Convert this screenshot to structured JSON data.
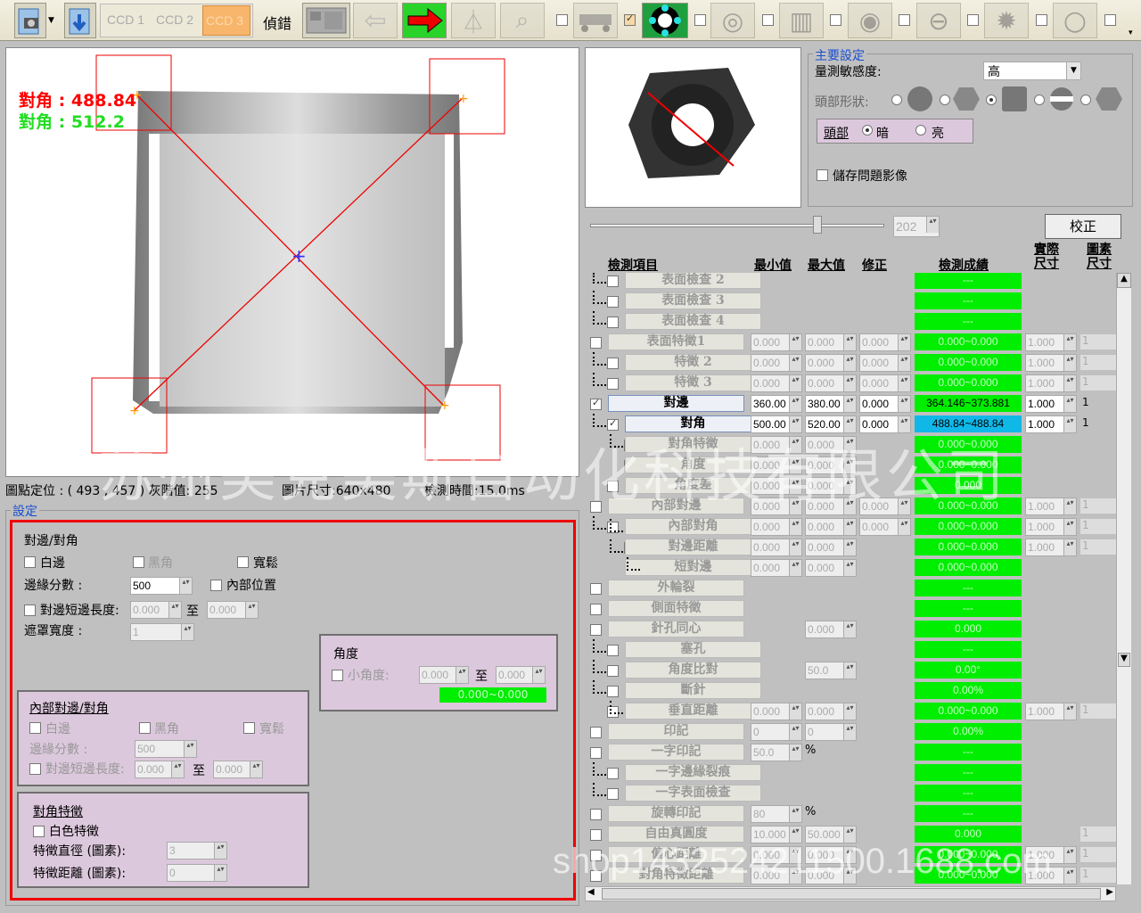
{
  "toolbar": {
    "ccd1": "CCD 1",
    "ccd2": "CCD 2",
    "ccd3": "CCD 3",
    "debug": "偵錯"
  },
  "image_view": {
    "diag_red": "對角 : 488.84",
    "diag_green": "對角 : 512.2",
    "status_pos": "圖點定位 : ( 493 , 457 ) 灰階值: 255",
    "status_size": "圖片尺寸:640x480",
    "status_time": "檢測時間:15.0ms"
  },
  "watermark1": "苏州美克美斯自动化科技有限公司",
  "watermark2": "shop1432524211500.1688.com",
  "settings": {
    "legend": "設定",
    "title": "對邊/對角",
    "white_edge": "白邊",
    "black_corner": "黑角",
    "loose": "寬鬆",
    "edge_score_label": "邊緣分數 :",
    "edge_score": "500",
    "inner_pos": "內部位置",
    "short_edge_label": "對邊短邊長度:",
    "short_min": "0.000",
    "to": "至",
    "short_max": "0.000",
    "mask_label": "遮罩寬度 :",
    "mask": "1",
    "angle_title": "角度",
    "small_angle": "小角度:",
    "angle_min": "0.000",
    "angle_max": "0.000",
    "angle_result": "0.000~0.000",
    "inner_title": "內部對邊/對角",
    "inner_white": "白邊",
    "inner_black": "黑角",
    "inner_loose": "寬鬆",
    "inner_score_label": "邊緣分數 :",
    "inner_score": "500",
    "inner_short_label": "對邊短邊長度:",
    "inner_short_min": "0.000",
    "inner_short_max": "0.000",
    "feat_title": "對角特徵",
    "feat_white": "白色特徵",
    "feat_dia_label": "特徵直徑 (圖素):",
    "feat_dia": "3",
    "feat_dist_label": "特徵距離 (圖素):",
    "feat_dist": "0"
  },
  "main_settings": {
    "legend": "主要設定",
    "sens_label": "量測敏感度:",
    "sens_value": "高",
    "head_shape": "頭部形狀:",
    "head_label": "頭部",
    "dark": "暗",
    "bright": "亮",
    "save_problem": "儲存問題影像"
  },
  "slider_value": "202",
  "calibrate": "校正",
  "table": {
    "h_item": "檢測項目",
    "h_min": "最小值",
    "h_max": "最大值",
    "h_fix": "修正",
    "h_result": "檢測成績",
    "h_real": "實際尺寸",
    "h_pix": "圖素尺寸",
    "rows": [
      {
        "name": "表面檢查 2",
        "min": "",
        "max": "",
        "fix": "",
        "res": "---",
        "real": "",
        "pix": "",
        "act": false
      },
      {
        "name": "表面檢查 3",
        "min": "",
        "max": "",
        "fix": "",
        "res": "---",
        "real": "",
        "pix": "",
        "act": false
      },
      {
        "name": "表面檢查 4",
        "min": "",
        "max": "",
        "fix": "",
        "res": "---",
        "real": "",
        "pix": "",
        "act": false
      },
      {
        "name": "表面特徵1",
        "min": "0.000",
        "max": "0.000",
        "fix": "0.000",
        "res": "0.000~0.000",
        "real": "1.000",
        "pix": "1",
        "act": false
      },
      {
        "name": "特徵 2",
        "min": "0.000",
        "max": "0.000",
        "fix": "0.000",
        "res": "0.000~0.000",
        "real": "1.000",
        "pix": "1",
        "act": false
      },
      {
        "name": "特徵 3",
        "min": "0.000",
        "max": "0.000",
        "fix": "0.000",
        "res": "0.000~0.000",
        "real": "1.000",
        "pix": "1",
        "act": false
      },
      {
        "name": "對邊",
        "min": "360.00",
        "max": "380.00",
        "fix": "0.000",
        "res": "364.146~373.881",
        "real": "1.000",
        "pix": "1",
        "act": true
      },
      {
        "name": "對角",
        "min": "500.00",
        "max": "520.00",
        "fix": "0.000",
        "res": "488.84~488.84",
        "real": "1.000",
        "pix": "1",
        "act": true,
        "blue": true
      },
      {
        "name": "對角特徵",
        "min": "0.000",
        "max": "0.000",
        "fix": "",
        "res": "0.000~0.000",
        "real": "",
        "pix": "",
        "act": false
      },
      {
        "name": "角度",
        "min": "0.000",
        "max": "0.000",
        "fix": "",
        "res": "0.000~0.000",
        "real": "",
        "pix": "",
        "act": false
      },
      {
        "name": "角度差",
        "min": "0.000",
        "max": "0.000",
        "fix": "",
        "res": "0.000",
        "real": "",
        "pix": "",
        "act": false
      },
      {
        "name": "內部對邊",
        "min": "0.000",
        "max": "0.000",
        "fix": "0.000",
        "res": "0.000~0.000",
        "real": "1.000",
        "pix": "1",
        "act": false
      },
      {
        "name": "內部對角",
        "min": "0.000",
        "max": "0.000",
        "fix": "0.000",
        "res": "0.000~0.000",
        "real": "1.000",
        "pix": "1",
        "act": false
      },
      {
        "name": "對邊距離",
        "min": "0.000",
        "max": "0.000",
        "fix": "",
        "res": "0.000~0.000",
        "real": "1.000",
        "pix": "1",
        "act": false
      },
      {
        "name": "短對邊",
        "min": "0.000",
        "max": "0.000",
        "fix": "",
        "res": "0.000~0.000",
        "real": "",
        "pix": "",
        "act": false
      },
      {
        "name": "外輪裂",
        "min": "",
        "max": "",
        "fix": "",
        "res": "---",
        "real": "",
        "pix": "",
        "act": false
      },
      {
        "name": "側面特徵",
        "min": "",
        "max": "",
        "fix": "",
        "res": "---",
        "real": "",
        "pix": "",
        "act": false
      },
      {
        "name": "針孔同心",
        "min": "",
        "max": "0.000",
        "fix": "",
        "res": "0.000",
        "real": "",
        "pix": "",
        "act": false
      },
      {
        "name": "塞孔",
        "min": "",
        "max": "",
        "fix": "",
        "res": "---",
        "real": "",
        "pix": "",
        "act": false
      },
      {
        "name": "角度比對",
        "min": "",
        "max": "50.0",
        "fix": "",
        "res": "0.00°",
        "real": "",
        "pix": "",
        "act": false
      },
      {
        "name": "斷針",
        "min": "",
        "max": "",
        "fix": "",
        "res": "0.00%",
        "real": "",
        "pix": "",
        "act": false
      },
      {
        "name": "垂直距離",
        "min": "0.000",
        "max": "0.000",
        "fix": "",
        "res": "0.000~0.000",
        "real": "1.000",
        "pix": "1",
        "act": false
      },
      {
        "name": "印記",
        "min": "0",
        "max": "0",
        "fix": "",
        "res": "0.00%",
        "real": "",
        "pix": "",
        "act": false
      },
      {
        "name": "一字印記",
        "min": "50.0",
        "max": "%",
        "fix": "",
        "res": "---",
        "real": "",
        "pix": "",
        "act": false
      },
      {
        "name": "一字邊緣裂痕",
        "min": "",
        "max": "",
        "fix": "",
        "res": "---",
        "real": "",
        "pix": "",
        "act": false
      },
      {
        "name": "一字表面檢查",
        "min": "",
        "max": "",
        "fix": "",
        "res": "---",
        "real": "",
        "pix": "",
        "act": false
      },
      {
        "name": "旋轉印記",
        "min": "80",
        "max": "%",
        "fix": "",
        "res": "---",
        "real": "",
        "pix": "",
        "act": false
      },
      {
        "name": "自由真圓度",
        "min": "10.000",
        "max": "50.000",
        "fix": "",
        "res": "0.000",
        "real": "",
        "pix": "1",
        "act": false
      },
      {
        "name": "偏心距離",
        "min": "0.000",
        "max": "0.000",
        "fix": "",
        "res": "0.000~0.000",
        "real": "1.000",
        "pix": "1",
        "act": false
      },
      {
        "name": "對角特徵距離",
        "min": "0.000",
        "max": "0.000",
        "fix": "",
        "res": "0.000~0.000",
        "real": "1.000",
        "pix": "1",
        "act": false
      }
    ]
  }
}
